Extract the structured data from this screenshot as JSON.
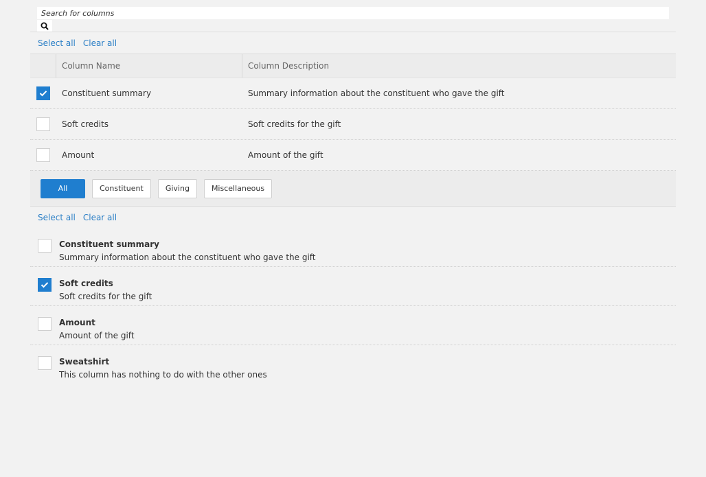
{
  "search": {
    "placeholder": "Search for columns"
  },
  "top_links": {
    "select_all": "Select all",
    "clear_all": "Clear all"
  },
  "table": {
    "headers": {
      "name": "Column Name",
      "description": "Column Description"
    },
    "rows": [
      {
        "name": "Constituent summary",
        "description": "Summary information about the constituent who gave the gift",
        "checked": true
      },
      {
        "name": "Soft credits",
        "description": "Soft credits for the gift",
        "checked": false
      },
      {
        "name": "Amount",
        "description": "Amount of the gift",
        "checked": false
      }
    ]
  },
  "filters": {
    "items": [
      "All",
      "Constituent",
      "Giving",
      "Miscellaneous"
    ],
    "active": "All"
  },
  "bottom_links": {
    "select_all": "Select all",
    "clear_all": "Clear all"
  },
  "list": {
    "items": [
      {
        "title": "Constituent summary",
        "description": "Summary information about the constituent who gave the gift",
        "checked": false
      },
      {
        "title": "Soft credits",
        "description": "Soft credits for the gift",
        "checked": true
      },
      {
        "title": "Amount",
        "description": "Amount of the gift",
        "checked": false
      },
      {
        "title": "Sweatshirt",
        "description": "This column has nothing to do with the other ones",
        "checked": false
      }
    ]
  },
  "colors": {
    "accent": "#1f7ecf",
    "link": "#2b7fc6",
    "background": "#f2f2f2"
  },
  "icons": {
    "search": "search-icon",
    "check": "checkmark-icon"
  }
}
